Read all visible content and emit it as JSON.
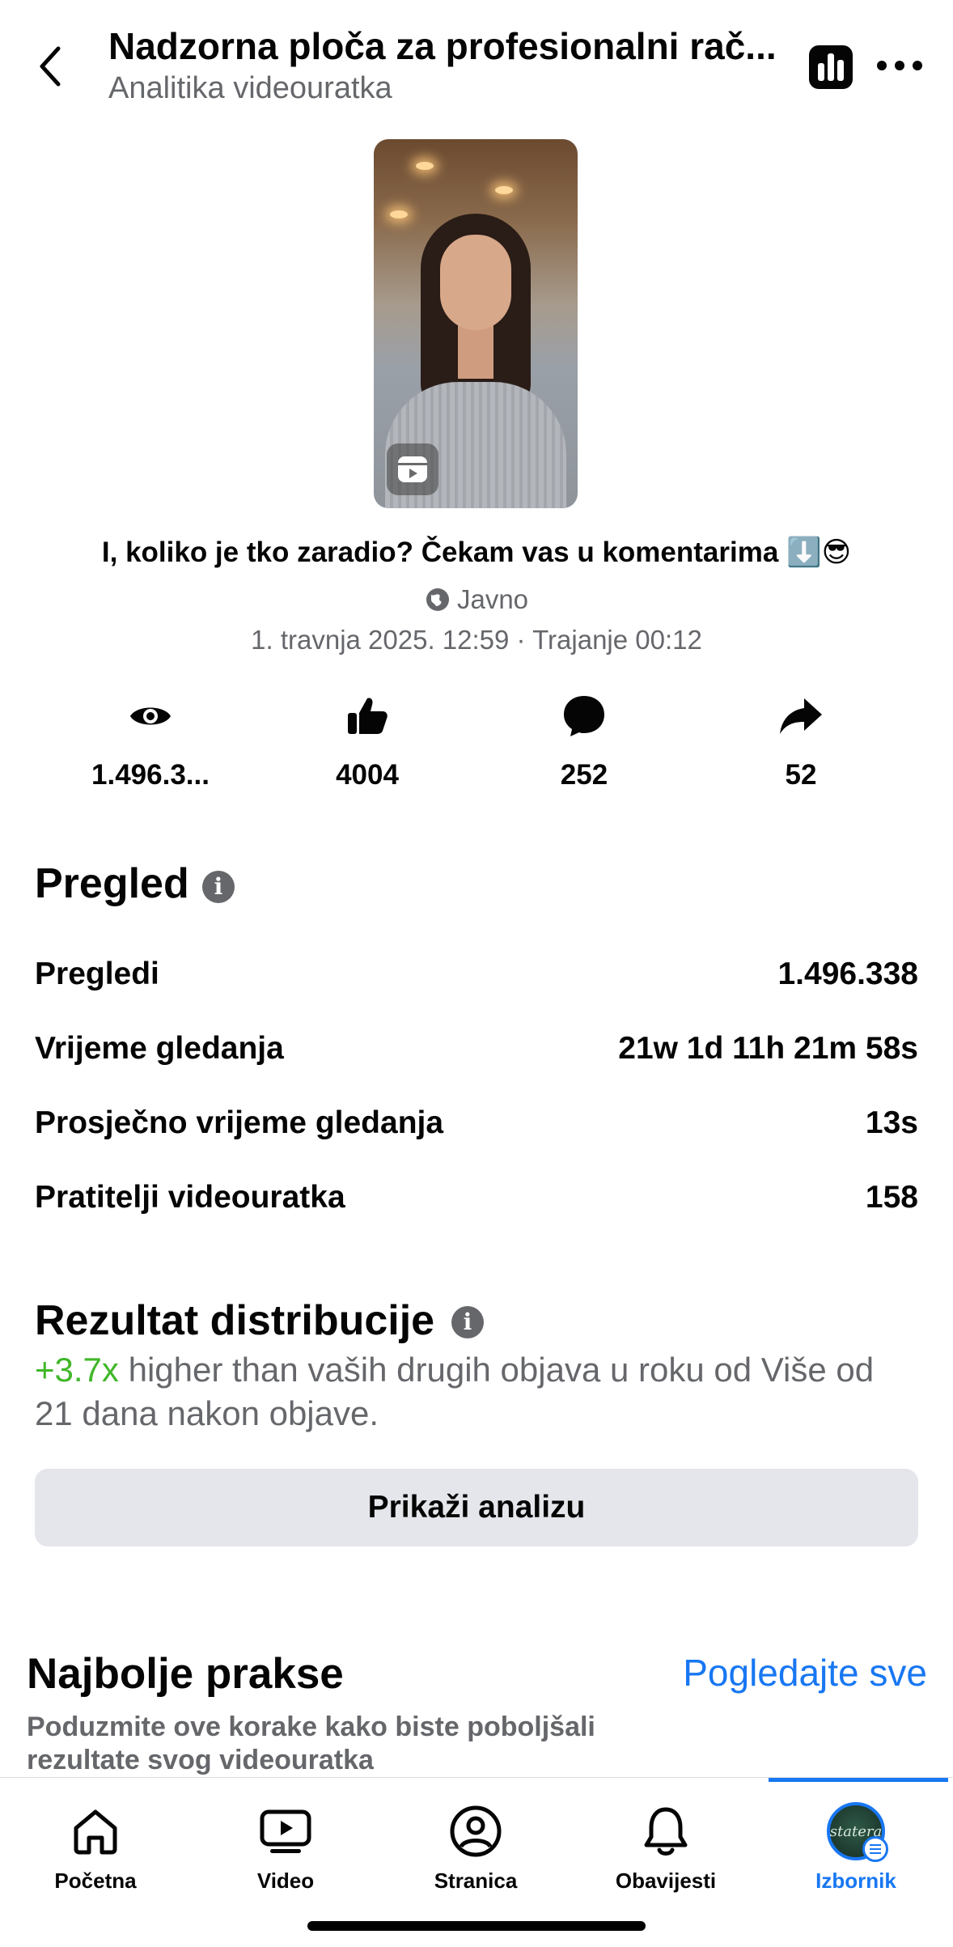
{
  "header": {
    "title": "Nadzorna ploča za profesionalni rač...",
    "subtitle": "Analitika videouratka"
  },
  "video": {
    "caption": "I, koliko je tko zaradio? Čekam vas u komentarima ⬇️😎",
    "visibility": "Javno",
    "meta": "1. travnja 2025. 12:59 · Trajanje 00:12"
  },
  "stats": [
    {
      "icon": "eye-icon",
      "value": "1.496.3..."
    },
    {
      "icon": "thumbs-up-icon",
      "value": "4004"
    },
    {
      "icon": "comment-icon",
      "value": "252"
    },
    {
      "icon": "share-icon",
      "value": "52"
    }
  ],
  "overview": {
    "title": "Pregled",
    "rows": [
      {
        "label": "Pregledi",
        "value": "1.496.338"
      },
      {
        "label": "Vrijeme gledanja",
        "value": "21w 1d 11h 21m 58s"
      },
      {
        "label": "Prosječno vrijeme gledanja",
        "value": "13s"
      },
      {
        "label": "Pratitelji videouratka",
        "value": "158"
      }
    ]
  },
  "distribution": {
    "title": "Rezultat distribucije",
    "highlight": "+3.7x",
    "text": " higher than vaših drugih objava u roku od Više od 21 dana nakon objave.",
    "highlight_color": "#42b72a",
    "button_label": "Prikaži analizu"
  },
  "best_practices": {
    "title": "Najbolje prakse",
    "link": "Pogledajte sve",
    "description": "Poduzmite ove korake kako biste poboljšali rezultate svog videouratka"
  },
  "bottom_nav": {
    "items": [
      {
        "label": "Početna",
        "icon": "home-icon"
      },
      {
        "label": "Video",
        "icon": "video-icon"
      },
      {
        "label": "Stranica",
        "icon": "profile-icon"
      },
      {
        "label": "Obavijesti",
        "icon": "bell-icon"
      },
      {
        "label": "Izbornik",
        "icon": "avatar-menu-icon",
        "active": true
      }
    ],
    "avatar_text": "statera"
  },
  "colors": {
    "accent": "#1877f2",
    "secondary_text": "#65676b",
    "button_bg": "#e4e6eb"
  }
}
